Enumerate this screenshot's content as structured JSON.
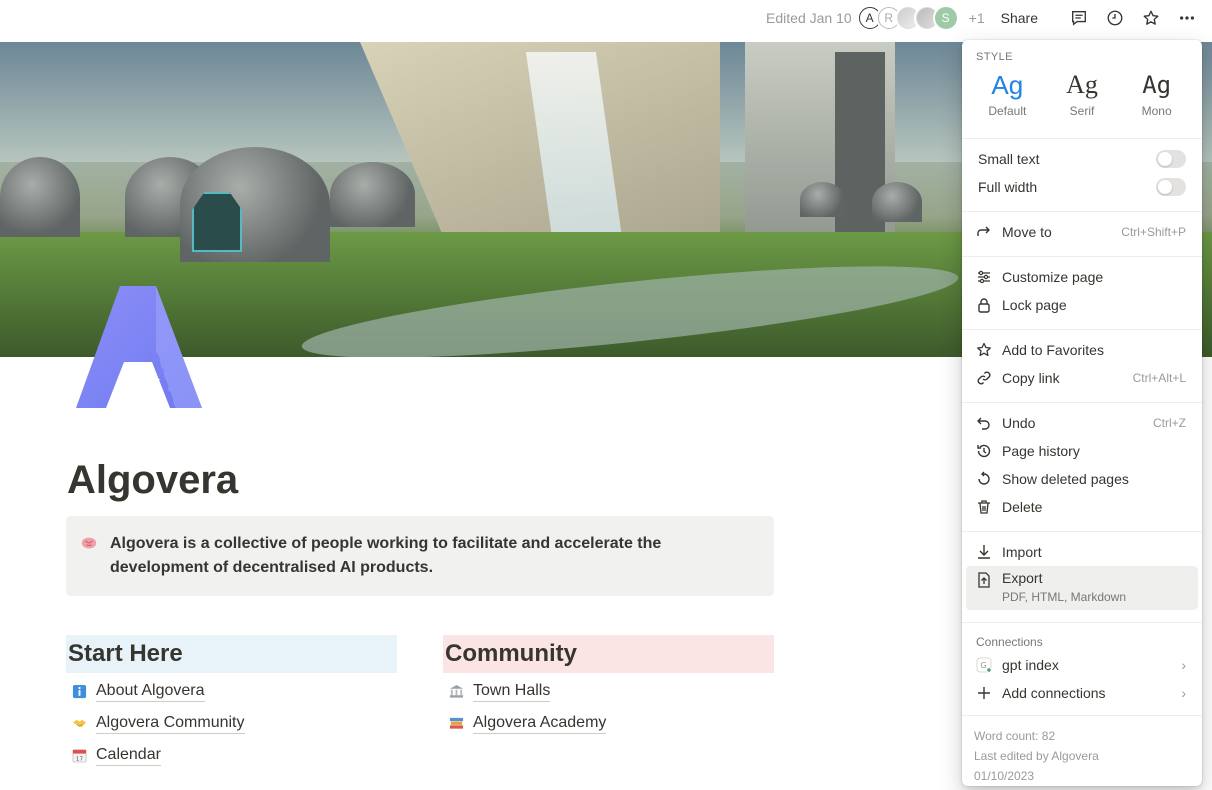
{
  "topbar": {
    "edited": "Edited Jan 10",
    "avatars": [
      "A",
      "R",
      "",
      "",
      "S"
    ],
    "extra_count": "+1",
    "share_label": "Share"
  },
  "page": {
    "title": "Algovera",
    "callout": "Algovera is a collective of people working to facilitate and accelerate the development of decentralised AI products."
  },
  "columns": [
    {
      "heading": "Start Here",
      "items": [
        "About Algovera",
        "Algovera Community",
        "Calendar"
      ]
    },
    {
      "heading": "Community",
      "items": [
        "Town Halls",
        "Algovera Academy"
      ]
    }
  ],
  "menu": {
    "style_label": "STYLE",
    "styles": [
      {
        "glyph": "Ag",
        "name": "Default"
      },
      {
        "glyph": "Ag",
        "name": "Serif"
      },
      {
        "glyph": "Ag",
        "name": "Mono"
      }
    ],
    "small_text": "Small text",
    "full_width": "Full width",
    "move_to": "Move to",
    "move_to_shortcut": "Ctrl+Shift+P",
    "customize_page": "Customize page",
    "lock_page": "Lock page",
    "add_to_favorites": "Add to Favorites",
    "copy_link": "Copy link",
    "copy_link_shortcut": "Ctrl+Alt+L",
    "undo": "Undo",
    "undo_shortcut": "Ctrl+Z",
    "page_history": "Page history",
    "show_deleted_pages": "Show deleted pages",
    "delete": "Delete",
    "import": "Import",
    "export": "Export",
    "export_sub": "PDF, HTML, Markdown",
    "connections_label": "Connections",
    "gpt_index": "gpt index",
    "add_connections": "Add connections",
    "word_count": "Word count: 82",
    "last_edited": "Last edited by Algovera",
    "last_edited_date": "01/10/2023"
  },
  "colors": {
    "accent": "#2383e2",
    "start_here_bg": "#e7f3f8",
    "community_bg": "#fbe4e4",
    "callout_bg": "#f1f1ef"
  }
}
